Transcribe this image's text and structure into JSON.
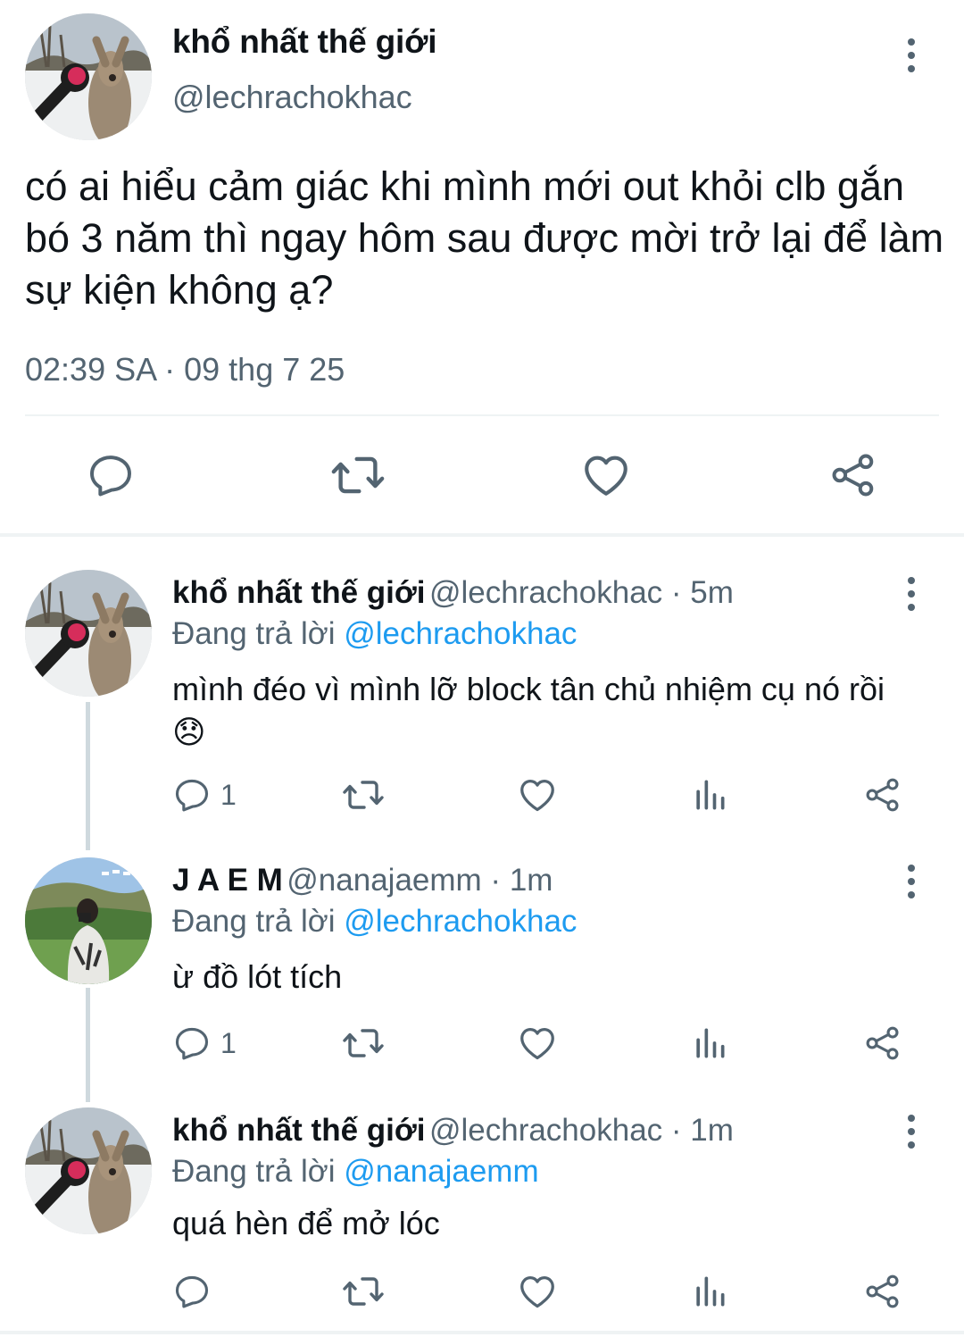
{
  "main_tweet": {
    "author_name": "khổ nhất thế giới",
    "handle": "@lechrachokhac",
    "text": "có ai hiểu cảm giác khi mình mới out khỏi clb gắn bó 3 năm thì ngay hôm sau được mời trở lại để làm sự kiện không ạ?",
    "timestamp": "02:39 SA · 09 thg 7 25",
    "actions": [
      "reply-icon",
      "retweet-icon",
      "like-icon",
      "share-icon"
    ]
  },
  "replies": [
    {
      "author_name": "khổ nhất thế giới",
      "handle": "@lechrachokhac",
      "separator": " · ",
      "time": "5m",
      "replying_prefix": "Đang trả lời ",
      "replying_to": "@lechrachokhac",
      "text": "mình đéo vì mình lỡ block tân chủ nhiệm cụ nó rồi",
      "emoji": "😞",
      "reply_count": "1"
    },
    {
      "author_name": "J A E M",
      "handle": "@nanajaemm",
      "separator": " · ",
      "time": "1m",
      "replying_prefix": "Đang trả lời ",
      "replying_to": "@lechrachokhac",
      "text": "ừ đồ lót tích",
      "reply_count": "1"
    },
    {
      "author_name": "khổ nhất thế giới",
      "handle": "@lechrachokhac",
      "separator": " · ",
      "time": "1m",
      "replying_prefix": "Đang trả lời ",
      "replying_to": "@nanajaemm",
      "text": "quá hèn để mở lóc",
      "reply_count": ""
    }
  ],
  "colors": {
    "text": "#0f1419",
    "secondary": "#536471",
    "mention": "#1d9bf0",
    "divider": "#eff3f4",
    "thread_line": "#cfd9de"
  }
}
